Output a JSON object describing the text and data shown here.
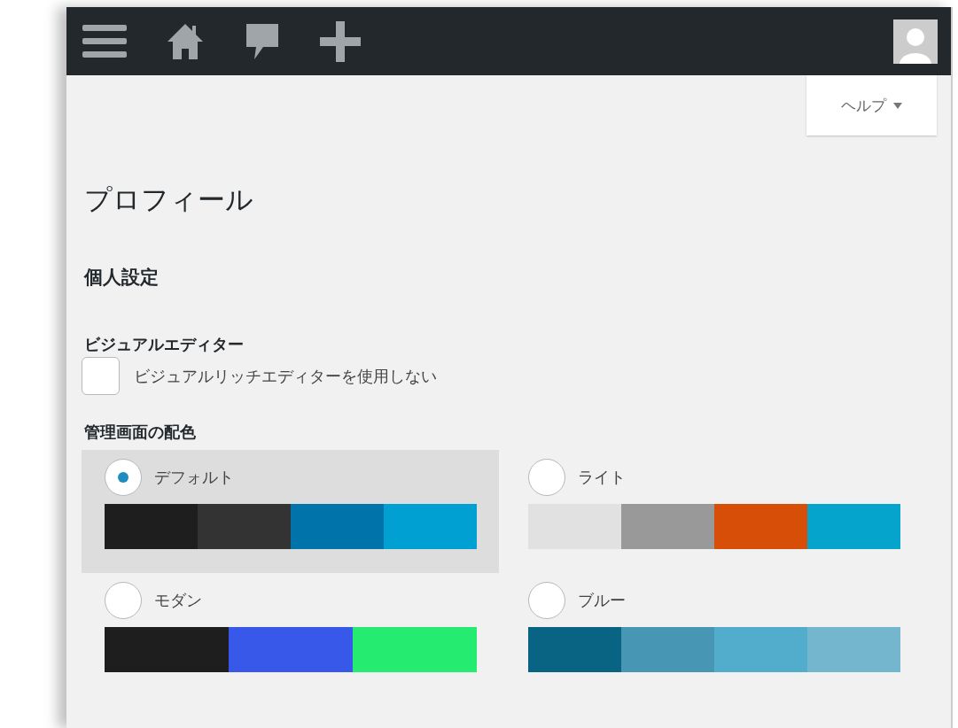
{
  "toolbar": {
    "items": [
      {
        "kind": "menu"
      },
      {
        "kind": "home"
      },
      {
        "kind": "comments"
      },
      {
        "kind": "new"
      },
      {
        "kind": "avatar"
      }
    ]
  },
  "help_button": {
    "label": "ヘルプ"
  },
  "title": "プロフィール",
  "section": "個人設定",
  "visual_editor": {
    "heading": "ビジュアルエディター",
    "checkbox": {
      "label": "ビジュアルリッチエディターを使用しない",
      "checked": false
    }
  },
  "color_scheme": {
    "heading": "管理画面の配色",
    "options": [
      {
        "label": "デフォルト",
        "selected": true,
        "swatches": [
          {
            "color": "#1e1e1e"
          },
          {
            "color": "#333333"
          },
          {
            "color": "#0073aa"
          },
          {
            "color": "#00a0d2"
          }
        ]
      },
      {
        "label": "ライト",
        "selected": false,
        "swatches": [
          {
            "color": "#e1e1e1"
          },
          {
            "color": "#999999"
          },
          {
            "color": "#d64e07"
          },
          {
            "color": "#04a4cc"
          }
        ]
      },
      {
        "label": "モダン",
        "selected": false,
        "swatches": [
          {
            "color": "#1e1e1e"
          },
          {
            "color": "#3858e9"
          },
          {
            "color": "#25ec70"
          }
        ]
      },
      {
        "label": "ブルー",
        "selected": false,
        "swatches": [
          {
            "color": "#096484"
          },
          {
            "color": "#4796b3"
          },
          {
            "color": "#52accc"
          },
          {
            "color": "#74b6ce"
          }
        ]
      }
    ]
  }
}
